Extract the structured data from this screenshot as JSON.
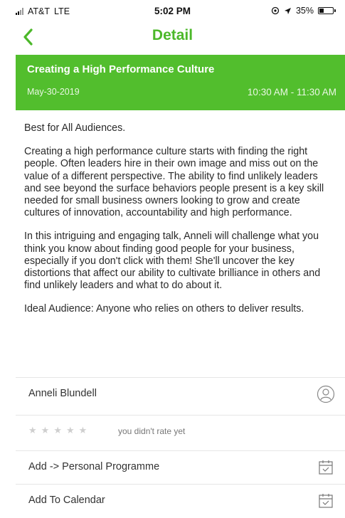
{
  "status_bar": {
    "carrier": "AT&T",
    "network": "LTE",
    "time": "5:02 PM",
    "battery_text": "35%",
    "battery_level": 0.35
  },
  "nav": {
    "back_icon": "chevron-left-icon",
    "title": "Detail",
    "accent_color": "#4cb82a"
  },
  "event": {
    "title": "Creating a High Performance Culture",
    "date": "May-30-2019",
    "time": "10:30 AM - 11:30 AM",
    "header_color": "#52be2d"
  },
  "description": {
    "p1": "Best for All Audiences.",
    "p2": "Creating a high performance culture starts with finding the right people. Often leaders hire in their own image and miss out on the value of a different perspective. The ability to find unlikely leaders and see beyond the surface behaviors people present is a key skill needed for small business owners looking to grow and create cultures of innovation, accountability and high performance.",
    "p3": "In this intriguing and engaging talk, Anneli will challenge what you think you know about finding good people for your business, especially if you don't click with them! She'll uncover the key distortions that affect our ability to cultivate brilliance in others and find unlikely leaders and what to do about it.",
    "p4": "Ideal Audience: Anyone who relies on others to deliver results."
  },
  "speaker": {
    "name": "Anneli Blundell",
    "icon": "person-icon"
  },
  "rating": {
    "stars": 0,
    "max": 5,
    "note": "you didn't rate yet"
  },
  "actions": {
    "personal_programme": "Add -> Personal Programme",
    "calendar": "Add To Calendar",
    "icon": "calendar-check-icon"
  }
}
